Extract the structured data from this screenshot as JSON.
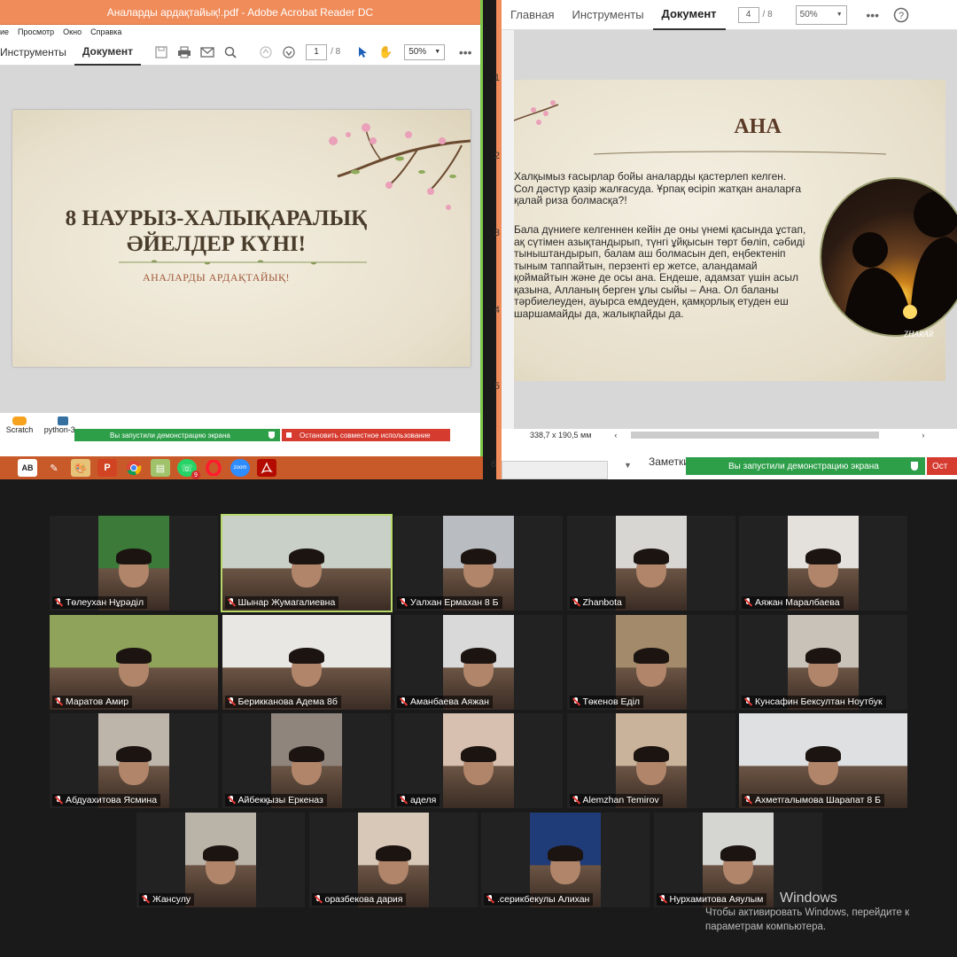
{
  "left_window": {
    "title": "Аналарды ардақтайық!.pdf - Adobe Acrobat Reader DC",
    "menu": [
      "ие",
      "Просмотр",
      "Окно",
      "Справка"
    ],
    "tabs": [
      "Инструменты",
      "Документ"
    ],
    "page_current": "1",
    "page_total": "/ 8",
    "zoom": "50%",
    "slide": {
      "title_line1": "8 НАУРЫЗ-ХАЛЫҚАРАЛЫҚ",
      "title_line2": "ӘЙЕЛДЕР КҮНІ!",
      "subtitle": "АНАЛАРДЫ АРДАҚТАЙЫҚ!"
    },
    "desktop_icons": [
      "Scratch",
      "python-3..."
    ],
    "share_text": "Вы запустили демонстрацию экрана",
    "stop_text": "Остановить совместное использование"
  },
  "taskbar": {
    "apps": [
      "ABBYY",
      "pencil",
      "paint",
      "powerpoint",
      "chrome",
      "notes",
      "whatsapp",
      "opera",
      "zoom",
      "acrobat"
    ],
    "whatsapp_badge": "9",
    "zoom_label": "zoom"
  },
  "right_window": {
    "tabs": [
      "Главная",
      "Инструменты",
      "Документ"
    ],
    "page_current": "4",
    "page_total": "/ 8",
    "zoom": "50%",
    "thumb_numbers": [
      "1",
      "2",
      "3",
      "4",
      "5",
      "6"
    ],
    "slide": {
      "title": "АНА",
      "paragraph1": "Халқымыз ғасырлар бойы аналарды қастерлеп келген. Сол дәстүр қазір жалғасуда. Ұрпақ өсіріп жатқан аналарға қалай риза болмасқа?!",
      "paragraph2": "Бала дүниеге келгеннен кейін де оны үнемі қасында ұстап, ақ сүтімен азықтандырып, түнгі ұйқысын төрт бөліп, сәбиді тыныштандырып, балам аш болмасын деп, еңбектеніп тыным таппайтын, перзенті ер жетсе, аландамай қоймайтын және де осы ана. Ендеше, адамзат үшін асыл қазына, Алланың берген ұлы сыйы – Ана. Ол баланы тәрбиелеуден, ауырса емдеуден, қамқорлық етуден еш шаршамайды да, жалықпайды да.",
      "watermark": "ZHARAR"
    },
    "dimensions": "338,7 x 190,5 мм",
    "notes_label": "Заметки",
    "share_text": "Вы запустили демонстрацию экрана",
    "stop_text": "Ост"
  },
  "gallery": {
    "participants": [
      {
        "name": "Төлеухан Нұрәділ",
        "bg": "#3c7a3a",
        "active": false
      },
      {
        "name": "Шынар Жумагалиевна",
        "bg": "#c9d0c8",
        "active": true
      },
      {
        "name": "Уалхан Ермахан 8 Б",
        "bg": "#b9bcc0",
        "active": false
      },
      {
        "name": "Zhanbota",
        "bg": "#d8d6d2",
        "active": false
      },
      {
        "name": "Аяжан Маралбаева",
        "bg": "#e4e0dc",
        "active": false
      },
      {
        "name": "Маратов Амир",
        "bg": "#8fa35a",
        "active": false
      },
      {
        "name": "Берикканова Адема 8б",
        "bg": "#e9e7e4",
        "active": false
      },
      {
        "name": "Аманбаева Аяжан",
        "bg": "#d9d9d9",
        "active": false
      },
      {
        "name": "Төкенов Еділ",
        "bg": "#a38a6a",
        "active": false
      },
      {
        "name": "Кунсафин Бексултан Ноутбук",
        "bg": "#c8c2b8",
        "active": false
      },
      {
        "name": "Абдуахитова Ясмина",
        "bg": "#bdb5aa",
        "active": false
      },
      {
        "name": "Айбекқызы Еркеназ",
        "bg": "#8f857c",
        "active": false
      },
      {
        "name": "аделя",
        "bg": "#d7c0b0",
        "active": false
      },
      {
        "name": "Alemzhan Temirov",
        "bg": "#c9b39a",
        "active": false
      },
      {
        "name": "Ахметгалымова Шарапат 8 Б",
        "bg": "#dfe0e2",
        "active": false
      },
      {
        "name": "Жансулу",
        "bg": "#b9b3a8",
        "active": false
      },
      {
        "name": "оразбекова дария",
        "bg": "#d7c8b8",
        "active": false
      },
      {
        "name": ".серикбекулы Алихан",
        "bg": "#1f3b78",
        "active": false
      },
      {
        "name": "Нурхамитова Аяулым",
        "bg": "#d5d5d2",
        "active": false
      }
    ]
  },
  "windows_activation": {
    "line1": "Windows",
    "line2": "Чтобы активировать Windows, перейдите к",
    "line3": "параметрам компьютера."
  }
}
